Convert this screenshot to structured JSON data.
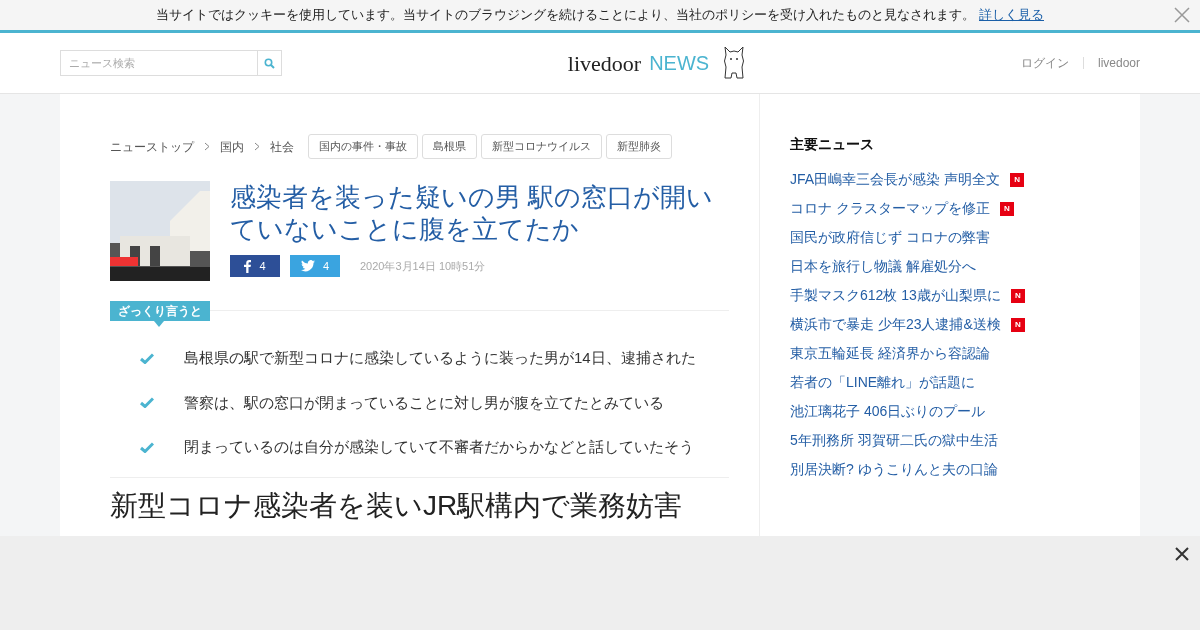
{
  "cookie_banner": {
    "message": "当サイトではクッキーを使用しています。当サイトのブラウジングを続けることにより、当社のポリシーを受け入れたものと見なされます。",
    "link": "詳しく見る"
  },
  "header": {
    "search": {
      "placeholder": "ニュース検索"
    },
    "logo": {
      "brand": "livedoor",
      "product": "NEWS"
    },
    "links": [
      "ログイン",
      "livedoor"
    ]
  },
  "breadcrumbs": [
    "ニューストップ",
    "国内",
    "社会"
  ],
  "tags": [
    "国内の事件・事故",
    "島根県",
    "新型コロナウイルス",
    "新型肺炎"
  ],
  "article": {
    "thumbnail": {
      "kind": "picture"
    },
    "title": "感染者を装った疑いの男 駅の窓口が開いていないことに腹を立てたか",
    "facebook_count": "4",
    "twitter_count": "4",
    "date": "2020年3月14日 10時51分",
    "summary_label": "ざっくり言うと",
    "summary": [
      "島根県の駅で新型コロナに感染しているように装った男が14日、逮捕された",
      "警察は、駅の窓口が閉まっていることに対し男が腹を立てたとみている",
      "閉まっているのは自分が感染していて不審者だからかなどと話していたそう"
    ],
    "headline": "新型コロナ感染者を装いJR駅構内で業務妨害"
  },
  "sidebar": {
    "title": "主要ニュース",
    "items": [
      {
        "text": "JFA田嶋幸三会長が感染 声明全文",
        "badge": "N"
      },
      {
        "text": "コロナ クラスターマップを修正",
        "badge": "N"
      },
      {
        "text": "国民が政府信じず コロナの弊害"
      },
      {
        "text": "日本を旅行し物議 解雇処分へ"
      },
      {
        "text": "手製マスク612枚 13歳が山梨県に",
        "badge": "N"
      },
      {
        "text": "横浜市で暴走 少年23人逮捕&送検",
        "badge": "N"
      },
      {
        "text": "東京五輪延長 経済界から容認論"
      },
      {
        "text": "若者の「LINE離れ」が話題に"
      },
      {
        "text": "池江璃花子 406日ぶりのプール"
      },
      {
        "text": "5年刑務所 羽賀研二氏の獄中生活"
      },
      {
        "text": "別居決断? ゆうこりんと夫の口論"
      }
    ]
  }
}
